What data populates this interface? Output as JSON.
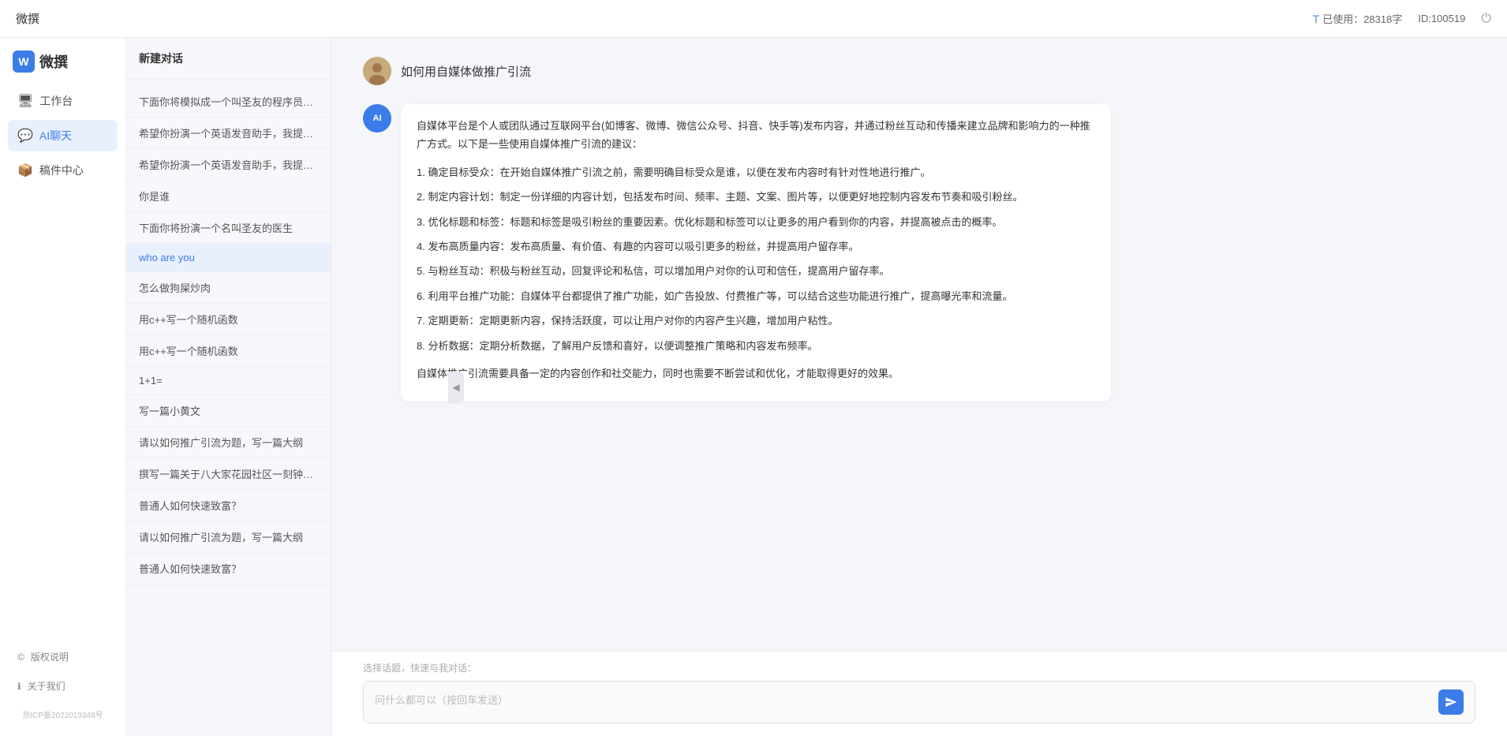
{
  "topbar": {
    "title": "微撰",
    "usage_icon": "T",
    "usage_label": "已使用：28318字",
    "id_label": "ID:100519",
    "power_icon": "⏻"
  },
  "sidebar": {
    "logo_letter": "W",
    "logo_text": "微撰",
    "nav_items": [
      {
        "id": "workbench",
        "icon": "🖥",
        "label": "工作台"
      },
      {
        "id": "ai-chat",
        "icon": "💬",
        "label": "AI聊天"
      },
      {
        "id": "components",
        "icon": "📦",
        "label": "稿件中心"
      }
    ],
    "footer_items": [
      {
        "id": "copyright",
        "icon": "©",
        "label": "版权说明"
      },
      {
        "id": "about",
        "icon": "ℹ",
        "label": "关于我们"
      }
    ],
    "icp": "京ICP备2022019348号"
  },
  "history": {
    "new_chat_label": "新建对话",
    "items": [
      {
        "id": 1,
        "text": "下面你将模拟成一个叫圣友的程序员，我说..."
      },
      {
        "id": 2,
        "text": "希望你扮演一个英语发音助手，我提供给你..."
      },
      {
        "id": 3,
        "text": "希望你扮演一个英语发音助手，我提供给你..."
      },
      {
        "id": 4,
        "text": "你是谁"
      },
      {
        "id": 5,
        "text": "下面你将扮演一个名叫圣友的医生"
      },
      {
        "id": 6,
        "text": "who are you"
      },
      {
        "id": 7,
        "text": "怎么做狗屎炒肉"
      },
      {
        "id": 8,
        "text": "用c++写一个随机函数"
      },
      {
        "id": 9,
        "text": "用c++写一个随机函数"
      },
      {
        "id": 10,
        "text": "1+1="
      },
      {
        "id": 11,
        "text": "写一篇小黄文"
      },
      {
        "id": 12,
        "text": "请以如何推广引流为题，写一篇大纲"
      },
      {
        "id": 13,
        "text": "撰写一篇关于八大家花园社区一刻钟便民生..."
      },
      {
        "id": 14,
        "text": "普通人如何快速致富？"
      },
      {
        "id": 15,
        "text": "请以如何推广引流为题，写一篇大纲"
      },
      {
        "id": 16,
        "text": "普通人如何快速致富？"
      }
    ]
  },
  "chat": {
    "user_message": "如何用自媒体做推广引流",
    "ai_response": {
      "intro": "自媒体平台是个人或团队通过互联网平台(如博客、微博、微信公众号、抖音、快手等)发布内容，并通过粉丝互动和传播来建立品牌和影响力的一种推广方式。以下是一些使用自媒体推广引流的建议：",
      "points": [
        "1. 确定目标受众：在开始自媒体推广引流之前，需要明确目标受众是谁，以便在发布内容时有针对性地进行推广。",
        "2. 制定内容计划：制定一份详细的内容计划，包括发布时间、频率、主题、文案、图片等，以便更好地控制内容发布节奏和吸引粉丝。",
        "3. 优化标题和标签：标题和标签是吸引粉丝的重要因素。优化标题和标签可以让更多的用户看到你的内容，并提高被点击的概率。",
        "4. 发布高质量内容：发布高质量、有价值、有趣的内容可以吸引更多的粉丝，并提高用户留存率。",
        "5. 与粉丝互动：积极与粉丝互动，回复评论和私信，可以增加用户对你的认可和信任，提高用户留存率。",
        "6. 利用平台推广功能：自媒体平台都提供了推广功能，如广告投放、付费推广等，可以结合这些功能进行推广，提高曝光率和流量。",
        "7. 定期更新：定期更新内容，保持活跃度，可以让用户对你的内容产生兴趣，增加用户粘性。",
        "8. 分析数据：定期分析数据，了解用户反馈和喜好，以便调整推广策略和内容发布频率。"
      ],
      "conclusion": "自媒体推广引流需要具备一定的内容创作和社交能力，同时也需要不断尝试和优化，才能取得更好的效果。"
    },
    "input_placeholder": "问什么都可以（按回车发送）",
    "quick_select_label": "选择话题，快速与我对话："
  }
}
